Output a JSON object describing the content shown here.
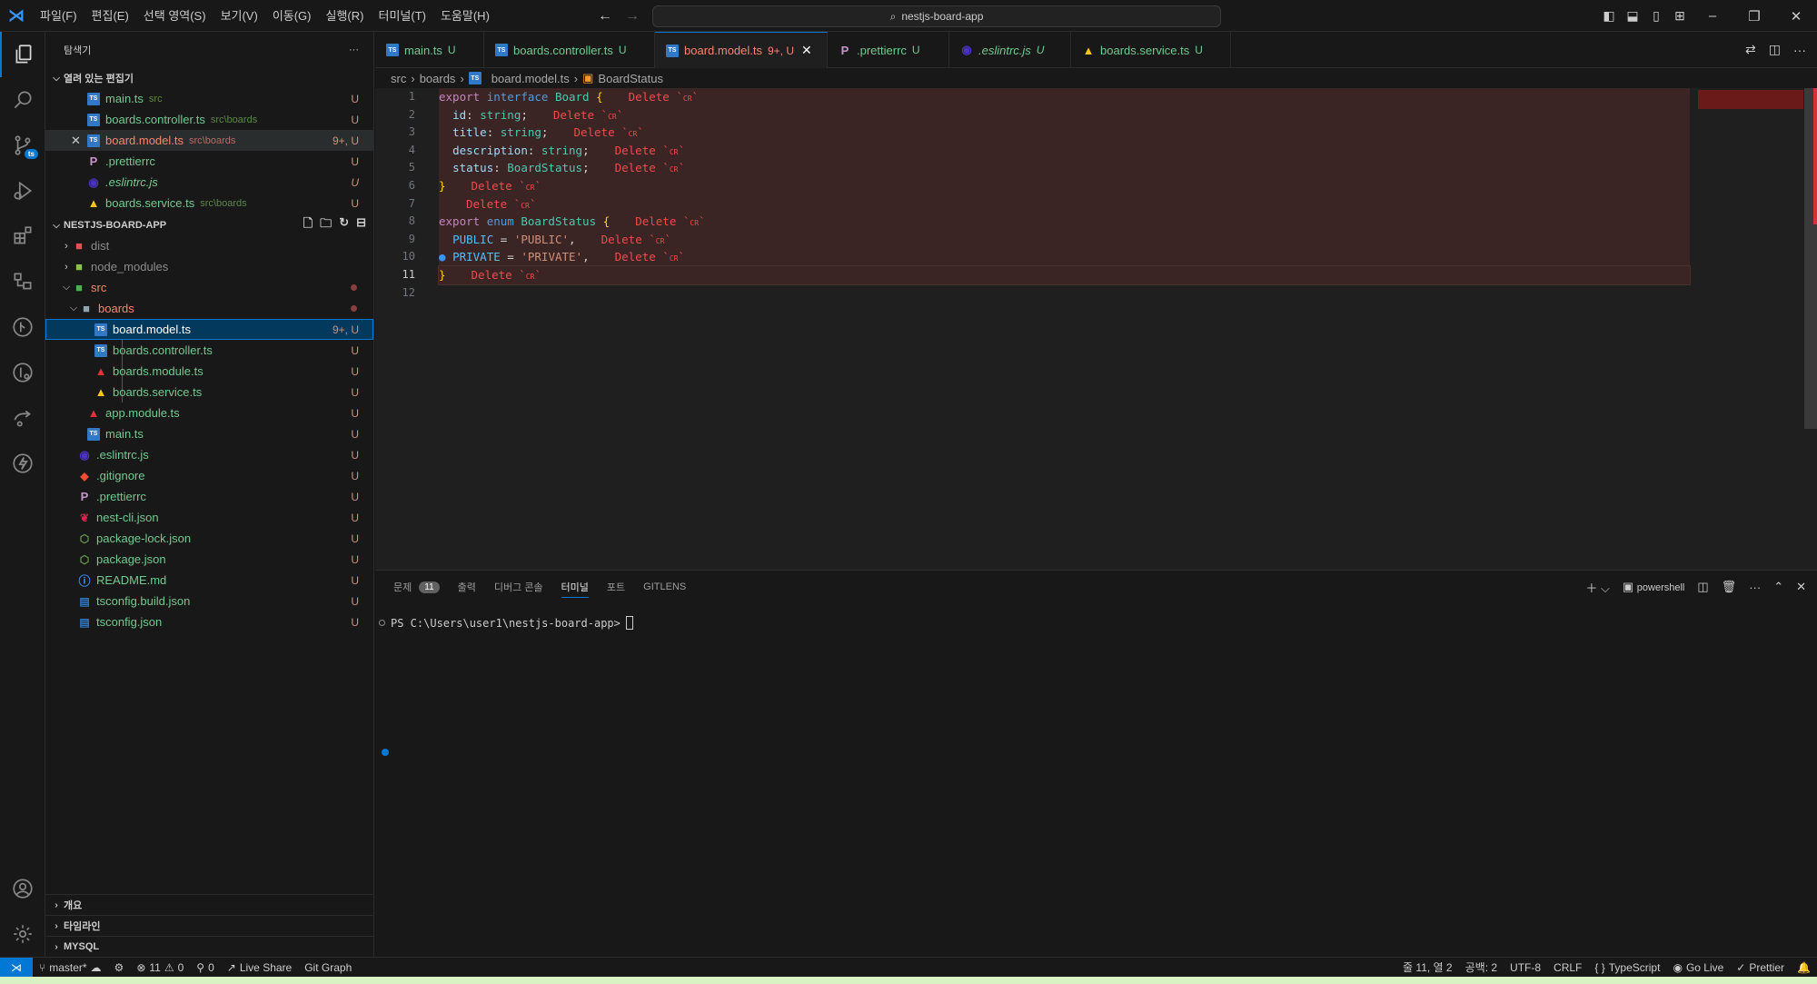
{
  "titlebar": {
    "menu": [
      "파일(F)",
      "편집(E)",
      "선택 영역(S)",
      "보기(V)",
      "이동(G)",
      "실행(R)",
      "터미널(T)",
      "도움말(H)"
    ],
    "search": "nestjs-board-app"
  },
  "activity_bar": {
    "source_control_badge": "ts"
  },
  "explorer": {
    "title": "탐색기",
    "open_editors_title": "열려 있는 편집기",
    "open_editors": [
      {
        "name": "main.ts",
        "desc": "src",
        "status": "U",
        "icon": "ts"
      },
      {
        "name": "boards.controller.ts",
        "desc": "src\\boards",
        "status": "U",
        "icon": "ts"
      },
      {
        "name": "board.model.ts",
        "desc": "src\\boards",
        "status": "9+, U",
        "icon": "ts"
      },
      {
        "name": ".prettierrc",
        "desc": "",
        "status": "U",
        "icon": "prettier"
      },
      {
        "name": ".eslintrc.js",
        "desc": "",
        "status": "U",
        "icon": "eslint"
      },
      {
        "name": "boards.service.ts",
        "desc": "src\\boards",
        "status": "U",
        "icon": "angular-service"
      }
    ],
    "project_title": "NESTJS-BOARD-APP",
    "tree": {
      "dist": "dist",
      "node_modules": "node_modules",
      "src": "src",
      "boards": "boards",
      "boards_files": [
        {
          "name": "board.model.ts",
          "status": "9+, U"
        },
        {
          "name": "boards.controller.ts",
          "status": "U"
        },
        {
          "name": "boards.module.ts",
          "status": "U"
        },
        {
          "name": "boards.service.ts",
          "status": "U"
        }
      ],
      "src_files": [
        {
          "name": "app.module.ts",
          "status": "U"
        },
        {
          "name": "main.ts",
          "status": "U"
        }
      ],
      "root_files": [
        {
          "name": ".eslintrc.js",
          "status": "U"
        },
        {
          "name": ".gitignore",
          "status": "U"
        },
        {
          "name": ".prettierrc",
          "status": "U"
        },
        {
          "name": "nest-cli.json",
          "status": "U"
        },
        {
          "name": "package-lock.json",
          "status": "U"
        },
        {
          "name": "package.json",
          "status": "U"
        },
        {
          "name": "README.md",
          "status": "U"
        },
        {
          "name": "tsconfig.build.json",
          "status": "U"
        },
        {
          "name": "tsconfig.json",
          "status": "U"
        }
      ]
    },
    "bottom_sections": [
      "개요",
      "타임라인",
      "MYSQL"
    ]
  },
  "tabs": [
    {
      "name": "main.ts",
      "status": "U"
    },
    {
      "name": "boards.controller.ts",
      "status": "U"
    },
    {
      "name": "board.model.ts",
      "status": "9+, U"
    },
    {
      "name": ".prettierrc",
      "status": "U"
    },
    {
      "name": ".eslintrc.js",
      "status": "U"
    },
    {
      "name": "boards.service.ts",
      "status": "U"
    }
  ],
  "breadcrumb": [
    "src",
    "boards",
    "board.model.ts",
    "BoardStatus"
  ],
  "editor": {
    "line_numbers": [
      "1",
      "2",
      "3",
      "4",
      "5",
      "6",
      "7",
      "8",
      "9",
      "10",
      "11",
      "12"
    ],
    "delete_hint": "Delete `",
    "cr_glyph": "CR",
    "backtick": "`",
    "lines": {
      "l1": {
        "a": "export",
        "b": "interface",
        "c": "Board",
        "d": "{"
      },
      "l2": {
        "a": "id",
        "b": ":",
        "c": "string",
        "d": ";"
      },
      "l3": {
        "a": "title",
        "b": ":",
        "c": "string",
        "d": ";"
      },
      "l4": {
        "a": "description",
        "b": ":",
        "c": "string",
        "d": ";"
      },
      "l5": {
        "a": "status",
        "b": ":",
        "c": "BoardStatus",
        "d": ";"
      },
      "l6": {
        "a": "}"
      },
      "l8": {
        "a": "export",
        "b": "enum",
        "c": "BoardStatus",
        "d": "{"
      },
      "l9": {
        "a": "PUBLIC",
        "b": "=",
        "c": "'PUBLIC'",
        "d": ","
      },
      "l10": {
        "a": "PRIVATE",
        "b": "=",
        "c": "'PRIVATE'",
        "d": ","
      },
      "l11": {
        "a": "}"
      }
    }
  },
  "panel": {
    "tabs": [
      "문제",
      "출력",
      "디버그 콘솔",
      "터미널",
      "포트",
      "GITLENS"
    ],
    "problems_count": "11",
    "shell": "powershell",
    "prompt": "PS C:\\Users\\user1\\nestjs-board-app>"
  },
  "statusbar": {
    "branch": "master*",
    "errors": "11",
    "warnings": "0",
    "ports": "0",
    "live_share": "Live Share",
    "git_graph": "Git Graph",
    "position": "줄 11, 열 2",
    "spaces": "공백: 2",
    "encoding": "UTF-8",
    "eol": "CRLF",
    "language": "TypeScript",
    "go_live": "Go Live",
    "prettier": "Prettier"
  },
  "colors": {
    "accent": "#0078d4",
    "untracked": "#73c991",
    "error": "#f14c4c"
  }
}
